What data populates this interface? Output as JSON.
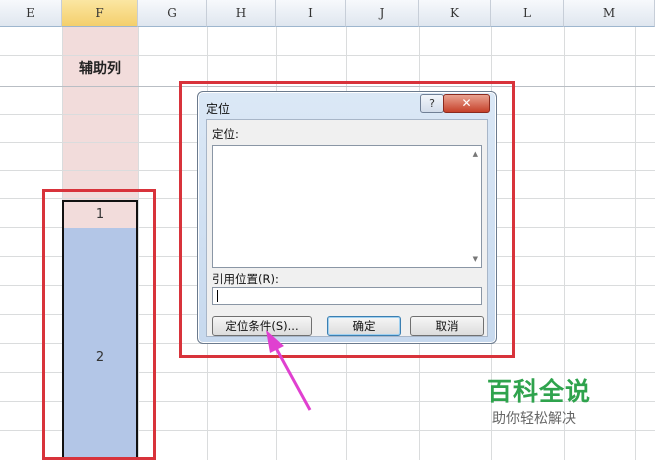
{
  "columns": [
    "E",
    "F",
    "G",
    "H",
    "I",
    "J",
    "K",
    "L",
    "M"
  ],
  "selected_column": "F",
  "aux_column_label": "辅助列",
  "cells": {
    "first": "1",
    "second": "2"
  },
  "dialog": {
    "title": "定位",
    "help_label": "?",
    "close_label": "✕",
    "goto_label": "定位:",
    "reference_label": "引用位置(R):",
    "reference_value": "",
    "special_button": "定位条件(S)...",
    "ok_button": "确定",
    "cancel_button": "取消"
  },
  "watermark": {
    "title": "百科全说",
    "subtitle": "助你轻松解决"
  },
  "colors": {
    "highlight_red": "#d8333b",
    "arrow": "#e040d0",
    "selected_fill_blue": "#b3c6e7",
    "aux_fill_pink": "#f2dcdb"
  }
}
